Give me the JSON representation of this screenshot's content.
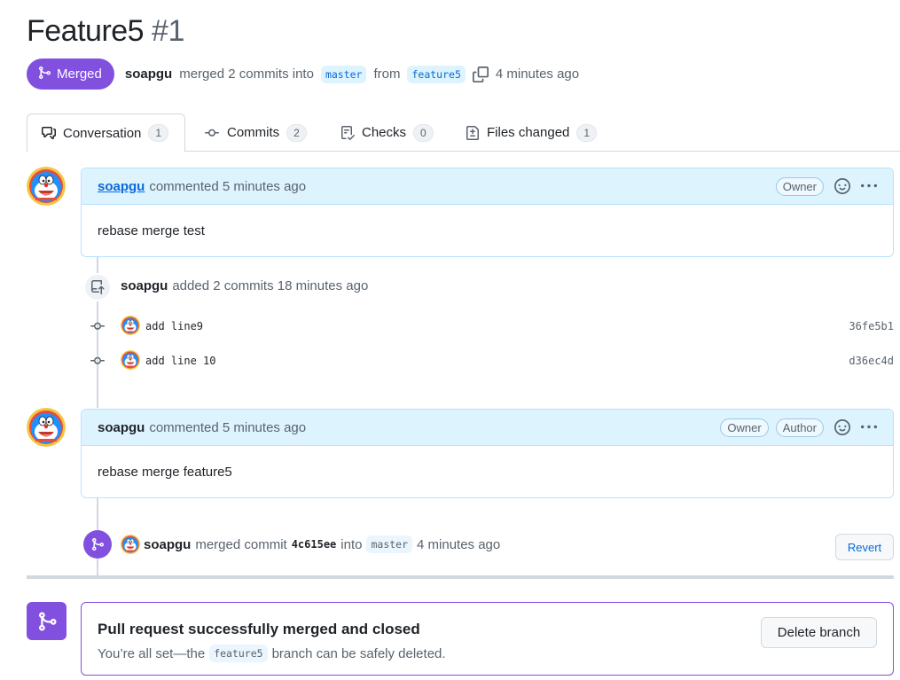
{
  "pr": {
    "title": "Feature5",
    "number": "#1",
    "state": "Merged",
    "merger": "soapgu",
    "merge_text": "merged 2 commits into",
    "base_branch": "master",
    "from_text": "from",
    "head_branch": "feature5",
    "time": "4 minutes ago"
  },
  "tabs": [
    {
      "label": "Conversation",
      "count": "1",
      "icon": "comment-discussion-icon"
    },
    {
      "label": "Commits",
      "count": "2",
      "icon": "git-commit-icon"
    },
    {
      "label": "Checks",
      "count": "0",
      "icon": "checklist-icon"
    },
    {
      "label": "Files changed",
      "count": "1",
      "icon": "file-diff-icon"
    }
  ],
  "comment1": {
    "author": "soapgu",
    "meta": "commented 5 minutes ago",
    "roles": [
      "Owner"
    ],
    "body": "rebase merge test"
  },
  "commits_event": {
    "author": "soapgu",
    "text": "added 2 commits 18 minutes ago",
    "commits": [
      {
        "message": "add line9",
        "sha": "36fe5b1"
      },
      {
        "message": "add line 10",
        "sha": "d36ec4d"
      }
    ]
  },
  "comment2": {
    "author": "soapgu",
    "meta": "commented 5 minutes ago",
    "roles": [
      "Owner",
      "Author"
    ],
    "body": "rebase merge feature5"
  },
  "merge_event": {
    "author": "soapgu",
    "text1": "merged commit",
    "sha": "4c615ee",
    "text2": "into",
    "branch": "master",
    "time": "4 minutes ago",
    "revert_label": "Revert"
  },
  "merge_box": {
    "title": "Pull request successfully merged and closed",
    "sub_prefix": "You’re all set—the",
    "branch": "feature5",
    "sub_suffix": "branch can be safely deleted.",
    "button": "Delete branch"
  },
  "colors": {
    "merged_purple": "#8250df",
    "link_blue": "#0969da",
    "comment_header_bg": "#ddf4ff"
  }
}
